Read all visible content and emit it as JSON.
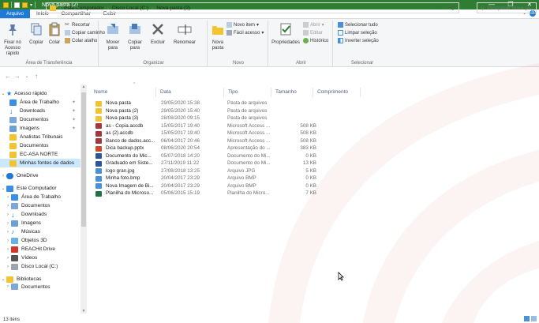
{
  "window": {
    "title": "Nova pasta (2)",
    "controls": [
      "—",
      "❐",
      "✕"
    ]
  },
  "tabs": [
    "Arquivo",
    "Início",
    "Compartilhar",
    "Exibir"
  ],
  "ribbon": {
    "area_transferencia": {
      "label": "Área de Transferência",
      "fixar": "Fixar no Acesso rápido",
      "copiar": "Copiar",
      "colar": "Colar",
      "recortar": "Recortar",
      "copiar_caminho": "Copiar caminho",
      "colar_atalho": "Colar atalho"
    },
    "organizar": {
      "label": "Organizar",
      "mover": "Mover para",
      "copiar_para": "Copiar para",
      "excluir": "Excluir",
      "renomear": "Renomear"
    },
    "novo": {
      "label": "Novo",
      "nova_pasta": "Nova pasta",
      "novo_item": "Novo item",
      "facil_acesso": "Fácil acesso"
    },
    "abrir": {
      "label": "Abrir",
      "propriedades": "Propriedades",
      "abrir": "Abrir",
      "editar": "Editar",
      "historico": "Histórico"
    },
    "selecionar": {
      "label": "Selecionar",
      "selecionar_tudo": "Selecionar tudo",
      "limpar_selecao": "Limpar seleção",
      "inverter_selecao": "Inverter seleção"
    }
  },
  "address": {
    "crumbs": [
      "Este Computador",
      "Disco Local (C:)",
      "Nova pasta (2)"
    ],
    "search_placeholder": "Pesquisar Nova pa..."
  },
  "nav": {
    "quick_access": "Acesso rápido",
    "quick_items": [
      "Área de Trabalho",
      "Downloads",
      "Documentos",
      "Imagens",
      "Analistas Tribunais",
      "Documentos",
      "EC-ASA NORTE",
      "Minhas fontes de dados"
    ],
    "onedrive": "OneDrive",
    "this_pc": "Este Computador",
    "pc_items": [
      "Área de Trabalho",
      "Documentos",
      "Downloads",
      "Imagens",
      "Músicas",
      "Objetos 3D",
      "REACHit Drive",
      "Vídeos",
      "Disco Local (C:)"
    ],
    "libraries": "Bibliotecas",
    "lib_items": [
      "Documentos"
    ]
  },
  "columns": [
    "Nome",
    "Data",
    "Tipo",
    "Tamanho",
    "Comprimento"
  ],
  "files": [
    {
      "name": "Nova pasta",
      "date": "29/05/2020 15:38",
      "type": "Pasta de arquivos",
      "size": "",
      "icon": "folder"
    },
    {
      "name": "Nova pasta (2)",
      "date": "29/05/2020 15:40",
      "type": "Pasta de arquivos",
      "size": "",
      "icon": "folder"
    },
    {
      "name": "Nova pasta (3)",
      "date": "28/08/2020 09:15",
      "type": "Pasta de arquivos",
      "size": "",
      "icon": "folder"
    },
    {
      "name": "as - Copia.accdb",
      "date": "15/05/2017 19:40",
      "type": "Microsoft Access ...",
      "size": "508 KB",
      "icon": "access"
    },
    {
      "name": "as (2).accdb",
      "date": "15/05/2017 19:40",
      "type": "Microsoft Access ...",
      "size": "508 KB",
      "icon": "access"
    },
    {
      "name": "Banco de dados.acc...",
      "date": "06/04/2017 20:46",
      "type": "Microsoft Access ...",
      "size": "508 KB",
      "icon": "access"
    },
    {
      "name": "Dica backup.pptx",
      "date": "08/06/2020 20:54",
      "type": "Apresentação do ...",
      "size": "383 KB",
      "icon": "ppt"
    },
    {
      "name": "Documento do Mic...",
      "date": "05/07/2018 14:20",
      "type": "Documento do Mi...",
      "size": "0 KB",
      "icon": "word"
    },
    {
      "name": "Graduado em Siste...",
      "date": "27/11/2019 11:22",
      "type": "Documento do Mi...",
      "size": "13 KB",
      "icon": "word"
    },
    {
      "name": "logo gran.jpg",
      "date": "27/08/2018 13:25",
      "type": "Arquivo JPG",
      "size": "5 KB",
      "icon": "image"
    },
    {
      "name": "Minha foto.bmp",
      "date": "20/04/2017 23:29",
      "type": "Arquivo BMP",
      "size": "0 KB",
      "icon": "image"
    },
    {
      "name": "Nova Imagem de Bi...",
      "date": "20/04/2017 23:29",
      "type": "Arquivo BMP",
      "size": "0 KB",
      "icon": "image"
    },
    {
      "name": "Planilha do Microso...",
      "date": "05/06/2015 15:19",
      "type": "Planilha do Micro...",
      "size": "7 KB",
      "icon": "excel"
    }
  ],
  "status": "13 itens",
  "colors": {
    "titlebar": "#2e7d32",
    "accent": "#1e7ad2",
    "selected": "#cce8ff",
    "watermark": "#d32f2f"
  }
}
